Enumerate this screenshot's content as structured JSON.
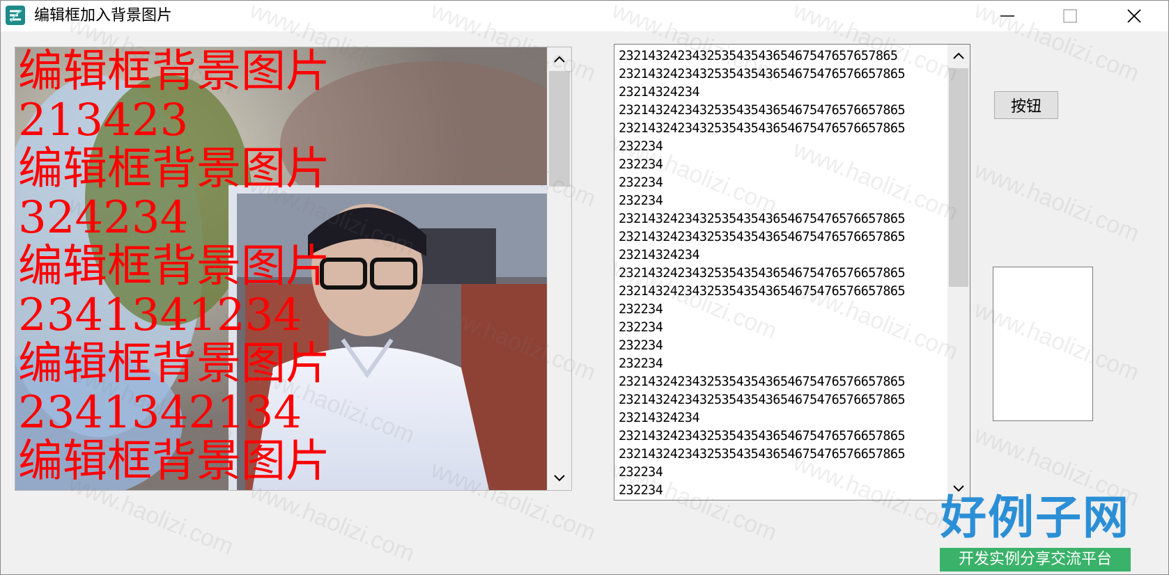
{
  "window": {
    "title": "编辑框加入背景图片",
    "icon": "app-logo-icon",
    "controls": [
      "minimize-icon",
      "maximize-icon",
      "close-icon"
    ]
  },
  "left_edit": {
    "text_color": "#ff0000",
    "lines": [
      "编辑框背景图片",
      "213423",
      "编辑框背景图片",
      "324234",
      "编辑框背景图片",
      "2341341234",
      "编辑框背景图片",
      "2341342134",
      "编辑框背景图片"
    ],
    "background": "photo of a young man with glasses in a white shirt"
  },
  "right_edit": {
    "lines": [
      "2321432423432535435436546754765765 7865",
      "23214324234325354354365467547657665 7865",
      "23214324234",
      "23214324234325354354365467547657665 7865",
      "23214324234325354354365467547657665 7865",
      "232234",
      "232234",
      "232234",
      "232234",
      "23214324234325354354365467547657665 7865",
      "23214324234325354354365467547657665 7865",
      "23214324234",
      "23214324234325354354365467547657665 7865",
      "23214324234325354354365467547657665 7865",
      "232234",
      "232234",
      "232234",
      "232234",
      "23214324234325354354365467547657665 7865",
      "23214324234325354354365467547657665 7865",
      "23214324234",
      "23214324234325354354365467547657665 7865",
      "23214324234325354354365467547657665 7865",
      "232234",
      "232234"
    ]
  },
  "button": {
    "label": "按钮"
  },
  "watermark": {
    "text": "www.haolizi.com",
    "logo_main": "好例子网",
    "logo_sub": "开发实例分享交流平台"
  },
  "colors": {
    "window_bg": "#f0f0f0",
    "logo_blue": "#2b8fd6",
    "logo_green": "#3ab26a"
  }
}
